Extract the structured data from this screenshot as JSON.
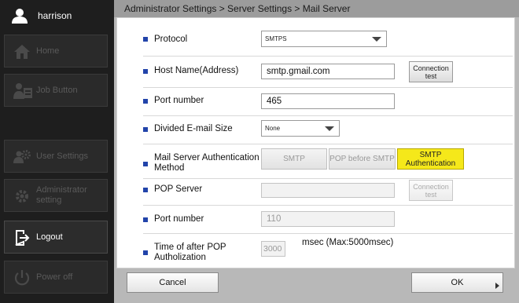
{
  "user": {
    "name": "harrison"
  },
  "sidebar": {
    "items": [
      {
        "label": "Home",
        "icon": "home-icon"
      },
      {
        "label": "Job Button",
        "icon": "job-button-icon"
      },
      {
        "label": "User Settings",
        "icon": "gear-user-icon"
      },
      {
        "label": "Administrator setting",
        "icon": "gear-admin-icon"
      },
      {
        "label": "Logout",
        "icon": "logout-icon"
      },
      {
        "label": "Power off",
        "icon": "power-icon"
      }
    ]
  },
  "breadcrumb": "Administrator Settings > Server Settings > Mail Server",
  "form": {
    "protocol": {
      "label": "Protocol",
      "value": "SMTPS"
    },
    "host": {
      "label": "Host Name(Address)",
      "value": "smtp.gmail.com",
      "test_label": "Connection test"
    },
    "port": {
      "label": "Port number",
      "value": "465"
    },
    "divided": {
      "label": "Divided E-mail Size",
      "value": "None"
    },
    "auth": {
      "label": "Mail Server Authentication Method",
      "options": [
        "SMTP",
        "POP before SMTP",
        "SMTP Authentication"
      ],
      "selected": "SMTP Authentication"
    },
    "pop_server": {
      "label": "POP Server",
      "value": "",
      "test_label": "Connection test"
    },
    "pop_port": {
      "label": "Port number",
      "value": "110"
    },
    "pop_time": {
      "label": "Time of after POP Autholization",
      "value": "3000",
      "suffix": "msec (Max:5000msec)"
    }
  },
  "footer": {
    "cancel_label": "Cancel",
    "ok_label": "OK"
  },
  "colors": {
    "accent_selected": "#f5e81a",
    "bullet": "#2244aa"
  }
}
